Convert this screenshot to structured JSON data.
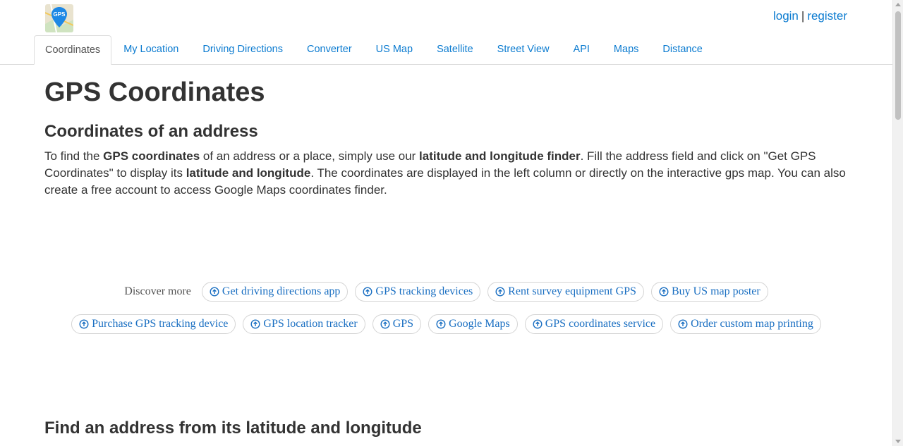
{
  "header": {
    "logo_text": "GPS",
    "login_label": "login",
    "separator": "|",
    "register_label": "register"
  },
  "tabs": [
    {
      "label": "Coordinates",
      "active": true
    },
    {
      "label": "My Location"
    },
    {
      "label": "Driving Directions"
    },
    {
      "label": "Converter"
    },
    {
      "label": "US Map"
    },
    {
      "label": "Satellite"
    },
    {
      "label": "Street View"
    },
    {
      "label": "API"
    },
    {
      "label": "Maps"
    },
    {
      "label": "Distance"
    }
  ],
  "main": {
    "title": "GPS Coordinates",
    "section1_title": "Coordinates of an address",
    "intro": {
      "t1": "To find the ",
      "b1": "GPS coordinates",
      "t2": " of an address or a place, simply use our ",
      "b2": "latitude and longitude finder",
      "t3": ". Fill the address field and click on \"Get GPS Coordinates\" to display its ",
      "b3": "latitude and longitude",
      "t4": ". The coordinates are displayed in the left column or directly on the interactive gps map. You can also create a free account to access Google Maps coordinates finder."
    },
    "section2_title": "Find an address from its latitude and longitude"
  },
  "discover": {
    "label": "Discover more",
    "row1": [
      "Get driving directions app",
      "GPS tracking devices",
      "Rent survey equipment GPS",
      "Buy US map poster"
    ],
    "row2": [
      "Purchase GPS tracking device",
      "GPS location tracker",
      "GPS",
      "Google Maps",
      "GPS coordinates service",
      "Order custom map printing"
    ]
  },
  "colors": {
    "link": "#0b7bd0",
    "pill_link": "#1a6fc2",
    "text": "#333333"
  }
}
